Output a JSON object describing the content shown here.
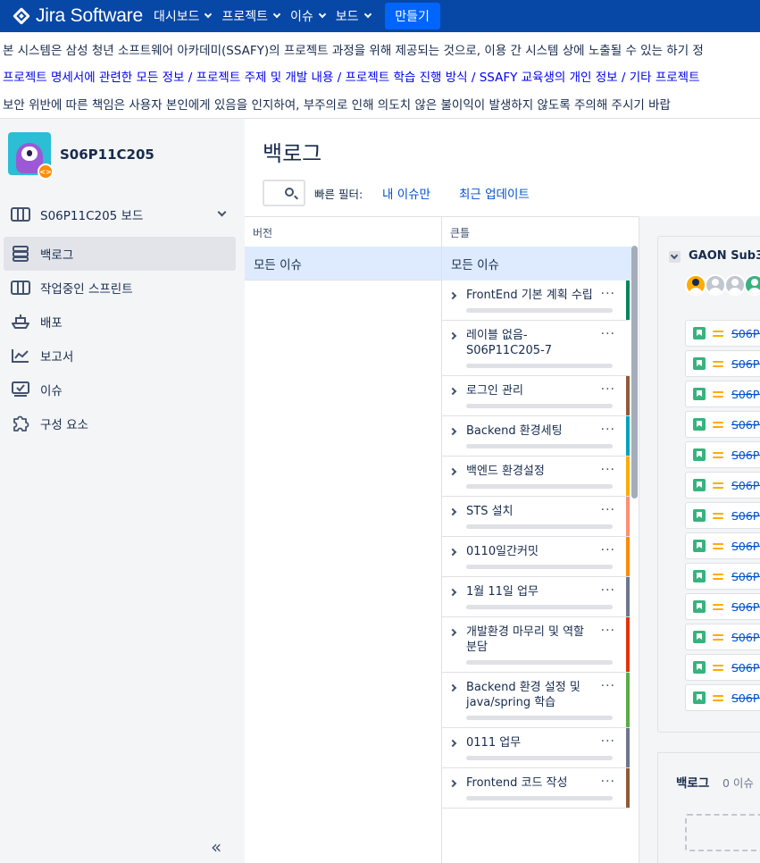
{
  "app": {
    "name": "Jira Software"
  },
  "topnav": {
    "items": [
      "대시보드",
      "프로젝트",
      "이슈",
      "보드"
    ],
    "create_label": "만들기"
  },
  "banner": {
    "line1": "본 시스템은 삼성 청년 소프트웨어 아카데미(SSAFY)의 프로젝트 과정을 위해 제공되는 것으로, 이용 간 시스템 상에 노출될 수 있는 하기 정",
    "line2": "프로젝트 명세서에 관련한 모든 정보 / 프로젝트 주제 및 개발 내용 / 프로젝트 학습 진행 방식 / SSAFY 교육생의 개인 정보 / 기타 프로젝트",
    "line3": "보안 위반에 따른 책임은 사용자 본인에게 있음을 인지하여, 부주의로 인해 의도치 않은 불이익이 발생하지 않도록 주의해 주시기 바랍"
  },
  "sidebar": {
    "project_name": "S06P11C205",
    "board_label": "S06P11C205 보드",
    "items": [
      {
        "label": "백로그",
        "icon": "backlog-icon",
        "active": true
      },
      {
        "label": "작업중인 스프린트",
        "icon": "sprint-board-icon",
        "active": false
      },
      {
        "label": "배포",
        "icon": "ship-icon",
        "active": false
      },
      {
        "label": "보고서",
        "icon": "reports-chart-icon",
        "active": false
      },
      {
        "label": "이슈",
        "icon": "issues-icon",
        "active": false
      },
      {
        "label": "구성 요소",
        "icon": "puzzle-icon",
        "active": false
      }
    ],
    "collapse_glyph": "«"
  },
  "main": {
    "title": "백로그",
    "quick_filter_label": "빠른 필터:",
    "quick_filters": [
      "내 이슈만",
      "최근 업데이트"
    ]
  },
  "versions": {
    "header": "버전",
    "all_label": "모든 이슈"
  },
  "epics": {
    "header": "큰틀",
    "all_label": "모든 이슈",
    "items": [
      {
        "title": "FrontEnd 기본 계획 수립",
        "color": "#00875a"
      },
      {
        "title": "레이블 없음- S06P11C205-7",
        "color": "#ffffff"
      },
      {
        "title": "로그인 관리",
        "color": "#8f5b3a"
      },
      {
        "title": "Backend 환경세팅",
        "color": "#00a3bf"
      },
      {
        "title": "백엔드 환경설정",
        "color": "#ffab00"
      },
      {
        "title": "STS 설치",
        "color": "#ff8f73"
      },
      {
        "title": "0110일간커밋",
        "color": "#ff8b00"
      },
      {
        "title": "1월 11일 업무",
        "color": "#6b778c"
      },
      {
        "title": "개발환경 마무리 및 역할 분담",
        "color": "#de350b"
      },
      {
        "title": "Backend 환경 설정 및 java/spring 학습",
        "color": "#5aac44"
      },
      {
        "title": "0111 업무",
        "color": "#6b778c"
      },
      {
        "title": "Frontend 코드 작성",
        "color": "#8f5b3a"
      }
    ]
  },
  "sprint": {
    "name": "GAON Sub3",
    "issues": [
      "S06P1",
      "S06P1",
      "S06P1",
      "S06P1",
      "S06P1",
      "S06P1",
      "S06P1",
      "S06P1",
      "S06P1",
      "S06P1",
      "S06P1",
      "S06P1",
      "S06P1"
    ]
  },
  "backlog": {
    "title": "백로그",
    "count": "0 이슈"
  }
}
